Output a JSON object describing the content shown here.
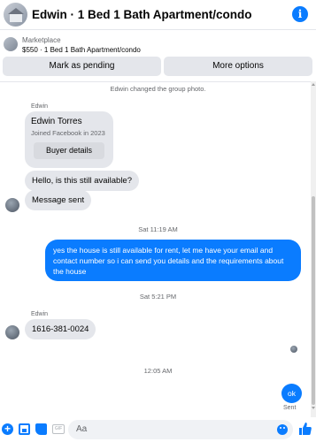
{
  "header": {
    "title": "Edwin · 1 Bed 1 Bath Apartment/condo",
    "info_icon": "info-icon"
  },
  "marketplace": {
    "label": "Marketplace",
    "listing": "$550 · 1 Bed 1 Bath Apartment/condo",
    "buttons": {
      "pending": "Mark as pending",
      "more": "More options"
    }
  },
  "chat": {
    "system_group_photo": "Edwin changed the group photo.",
    "sender_top": "Edwin",
    "card": {
      "name": "Edwin Torres",
      "joined": "Joined Facebook in 2023",
      "button": "Buyer details"
    },
    "msg_available": "Hello, is this still available?",
    "msg_sent": "Message sent",
    "time_1": "Sat 11:19 AM",
    "outgoing_1": "yes the house is still available for rent, let me have your email  and contact number so i can send you details and the requirements about the house",
    "time_2": "Sat 5:21 PM",
    "sender_bottom": "Edwin",
    "msg_phone": "1616-381-0024",
    "time_3": "12:05 AM",
    "outgoing_2": "ok",
    "status": "Sent"
  },
  "composer": {
    "placeholder": "Aa",
    "gif_label": "GIF",
    "icons": [
      "plus-icon",
      "photo-icon",
      "sticker-icon",
      "gif-icon",
      "emoji-icon",
      "like-icon"
    ]
  },
  "colors": {
    "accent": "#0a7cff",
    "incoming_bubble": "#e4e6eb",
    "muted_text": "#65676b"
  }
}
